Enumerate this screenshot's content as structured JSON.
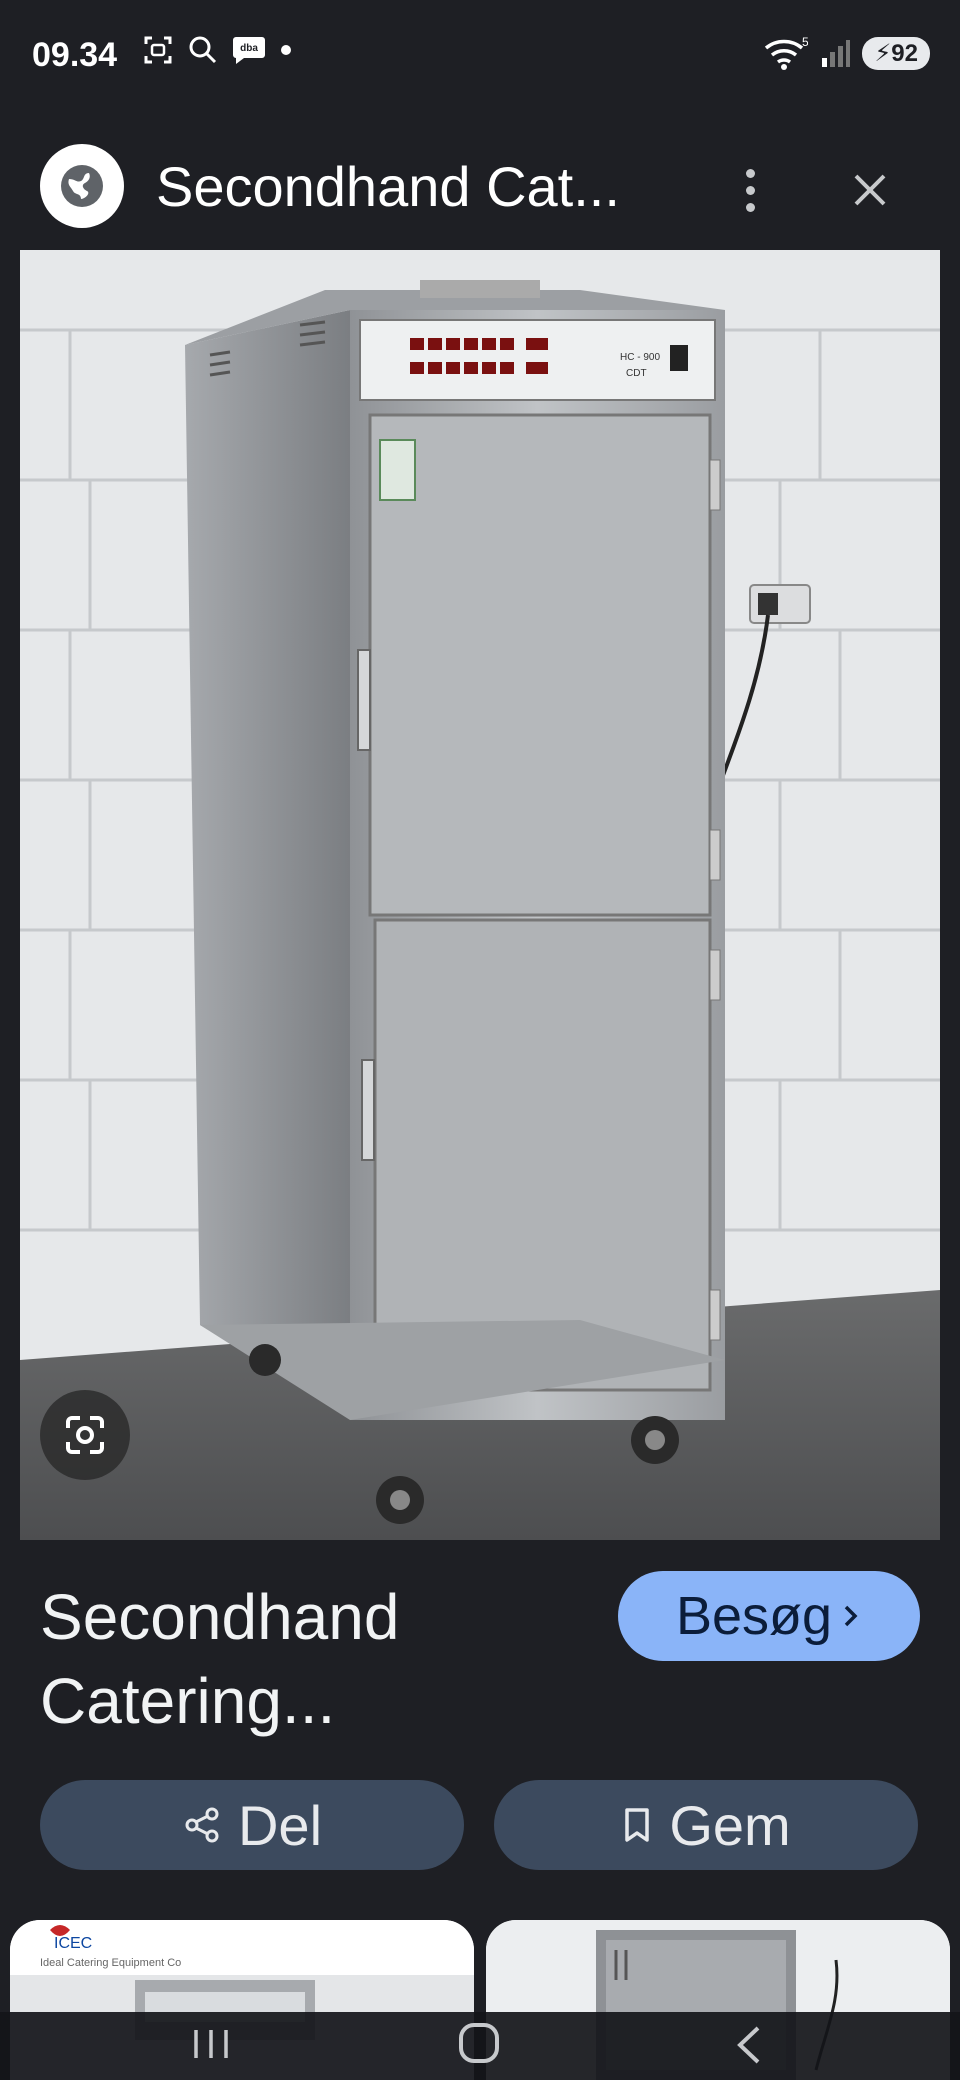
{
  "status_bar": {
    "time": "09.34",
    "battery": "92",
    "icons_left": [
      "screenshot-icon",
      "search-icon",
      "dba-icon",
      "dot-icon"
    ],
    "icons_right": [
      "wifi-icon",
      "signal-icon",
      "battery-icon"
    ]
  },
  "header": {
    "title": "Secondhand Cat...",
    "site_icon": "globe-icon",
    "more_icon": "more-vert-icon",
    "close_icon": "close-icon"
  },
  "image": {
    "panel_label_model": "HC - 900",
    "panel_label_sub": "CDT"
  },
  "result": {
    "title_line1": "Secondhand",
    "title_line2": "Catering...",
    "visit_label": "Besøg",
    "share_label": "Del",
    "save_label": "Gem"
  },
  "thumbnails": [
    {
      "brand": "ICEC",
      "caption": "Ideal Catering Equipment Co"
    },
    {
      "brand": "",
      "caption": ""
    }
  ],
  "colors": {
    "background": "#1e1f24",
    "visit_button": "#8ab4f8",
    "action_button": "#3c4a5e"
  }
}
